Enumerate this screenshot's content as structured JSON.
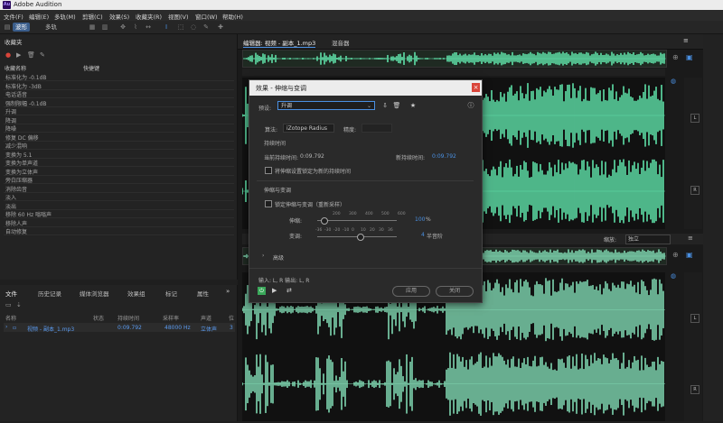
{
  "app": {
    "title": "Adobe Audition",
    "logo": "Au"
  },
  "menu": [
    "文件(F)",
    "编辑(E)",
    "多轨(M)",
    "剪辑(C)",
    "效果(S)",
    "收藏夹(R)",
    "视图(V)",
    "窗口(W)",
    "帮助(H)"
  ],
  "toolbar": {
    "waveform_label": "波形",
    "multitrack_label": "多轨"
  },
  "favorites": {
    "title": "收藏夹",
    "col_name": "收藏名称",
    "col_shortcut": "快捷键",
    "items": [
      "标准化为 -0.1dB",
      "标准化为 -3dB",
      "电话语音",
      "强制限幅 -0.1dB",
      "升调",
      "降调",
      "降噪",
      "修复 DC 偏移",
      "减少混响",
      "变换为 5.1",
      "变换为单声道",
      "变换为立体声",
      "旁白压缩器",
      "消除齿音",
      "淡入",
      "淡出",
      "移除 60 Hz 嗡嗡声",
      "移除人声",
      "自动修复"
    ]
  },
  "files": {
    "tabs": [
      "文件",
      "历史记录",
      "媒体浏览器",
      "效果组",
      "标记",
      "属性"
    ],
    "cols": [
      "名称",
      "状态",
      "持续时间",
      "采样率",
      "声道",
      "位"
    ],
    "row": {
      "name": "视频 - 副本_1.mp3",
      "duration": "0:09.792",
      "sample_rate": "48000 Hz",
      "channels": "立体声",
      "bits": "3"
    }
  },
  "editor": {
    "tab_label": "编辑器: 视频 - 副本_1.mp3",
    "mixer_label": "混音器",
    "zoom_label": "缩放:",
    "zoom_value": "独立",
    "channel_l": "L",
    "channel_r": "R"
  },
  "dialog": {
    "title": "效果 - 伸缩与变调",
    "preset_label": "预设:",
    "preset_value": "升调",
    "algorithm_label": "算法:",
    "algorithm_value": "iZotope Radius",
    "precision_label": "精度:",
    "duration_section": "持续时间",
    "current_duration_label": "当前持续时间:",
    "current_duration_value": "0:09.792",
    "new_duration_label": "新持续时间:",
    "new_duration_value": "0:09.792",
    "lock_duration_label": "将伸缩设置锁定为新的持续时间",
    "stretch_section": "伸缩与变调",
    "lock_stretch_label": "锁定伸缩与变调（重新采样）",
    "stretch_label": "伸缩:",
    "stretch_ticks": [
      "200",
      "300",
      "400",
      "500",
      "600"
    ],
    "stretch_value": "100",
    "stretch_unit": "%",
    "pitch_label": "变调:",
    "pitch_ticks": [
      "-36",
      "-30",
      "-20",
      "-10",
      "0",
      "10",
      "20",
      "30",
      "36"
    ],
    "pitch_value": "4",
    "pitch_unit": "半音阶",
    "advanced_label": "高级",
    "io_label": "输入: L, R  输出: L, R",
    "apply_label": "应用",
    "close_label": "关闭"
  },
  "colors": {
    "waveform": "#5fe0a8",
    "waveform_dim": "#7fd6b0",
    "accent": "#4a90e2"
  }
}
